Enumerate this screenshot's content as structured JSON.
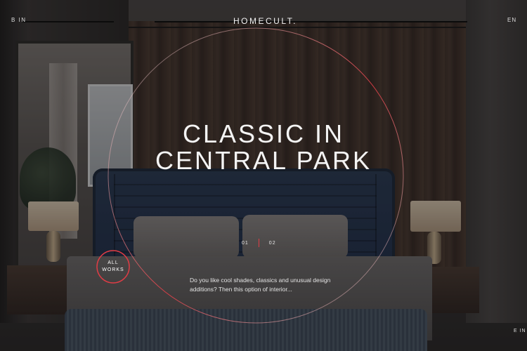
{
  "header": {
    "logo": "HOMECULT.",
    "nav_left": "B IN",
    "lang": "EN"
  },
  "hero": {
    "title_line1": "CLASSIC IN",
    "title_line2": "CENTRAL PARK",
    "description": "Do you like cool shades, classics and unusual design additions? Then this option of interior..."
  },
  "slider": {
    "current": "01",
    "next": "02"
  },
  "all_works": {
    "line1": "ALL",
    "line2": "WORKS"
  },
  "corner_bottom_right": "E IN",
  "colors": {
    "accent": "#e03c45",
    "text": "#f4f4f4"
  }
}
